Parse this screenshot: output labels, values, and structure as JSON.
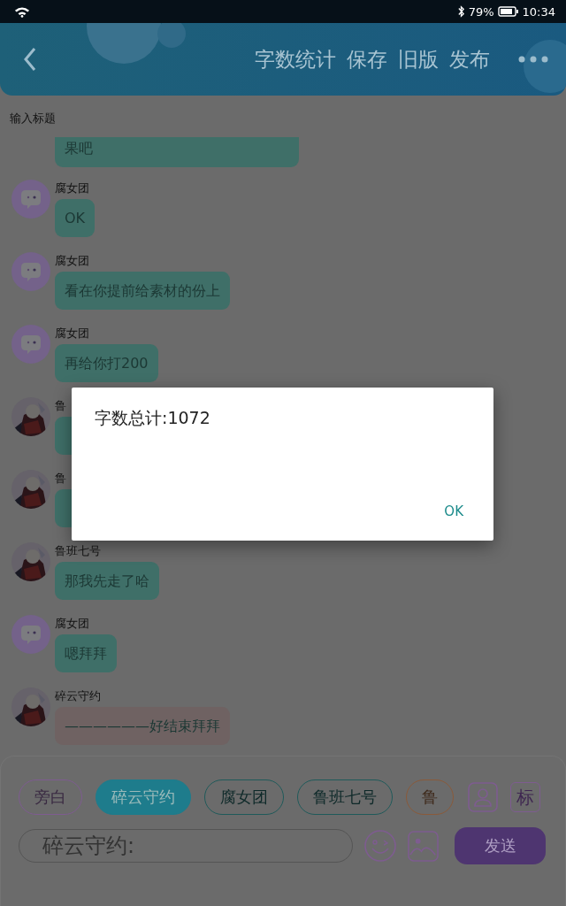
{
  "status_bar": {
    "battery": "79%",
    "time": "10:34"
  },
  "header": {
    "actions": [
      "字数统计",
      "保存",
      "旧版",
      "发布"
    ]
  },
  "title_field": {
    "placeholder": "输入标题"
  },
  "messages": [
    {
      "kind": "continued",
      "text": "果吧",
      "color": "#3f6f68"
    },
    {
      "kind": "icon_avatar",
      "name": "腐女团",
      "text": "OK",
      "color": "#3f6f68"
    },
    {
      "kind": "icon_avatar",
      "name": "腐女团",
      "text": "看在你提前给素材的份上",
      "color": "#3f6f68"
    },
    {
      "kind": "icon_avatar",
      "name": "腐女团",
      "text": "再给你打200",
      "color": "#3f6f68"
    },
    {
      "kind": "picture_avatar",
      "name": "鲁",
      "color": "#3f6f68"
    },
    {
      "kind": "picture_avatar",
      "name": "鲁",
      "color": "#3f6f68"
    },
    {
      "kind": "picture_avatar",
      "name": "鲁班七号",
      "text": "那我先走了哈",
      "color": "#3f6f68"
    },
    {
      "kind": "icon_avatar",
      "name": "腐女团",
      "text": "嗯拜拜",
      "color": "#3f6f68"
    },
    {
      "kind": "picture_avatar",
      "name": "碎云守约",
      "text": "——————好结束拜拜",
      "color": "#6f6262"
    }
  ],
  "roles": [
    {
      "label": "旁白",
      "selected": false,
      "color": "#7e5c90"
    },
    {
      "label": "碎云守约",
      "selected": true,
      "color": "#1e7c8c"
    },
    {
      "label": "腐女团",
      "selected": false,
      "color": "#1f5a5a"
    },
    {
      "label": "鲁班七号",
      "selected": false,
      "color": "#1f5a5a"
    },
    {
      "label": "鲁",
      "selected": false,
      "color": "#8a5a3a"
    }
  ],
  "tag_button": "标",
  "input": {
    "placeholder": "碎云守约:"
  },
  "send_button": "发送",
  "dialog": {
    "message": "字数总计:1072",
    "button": "OK"
  }
}
